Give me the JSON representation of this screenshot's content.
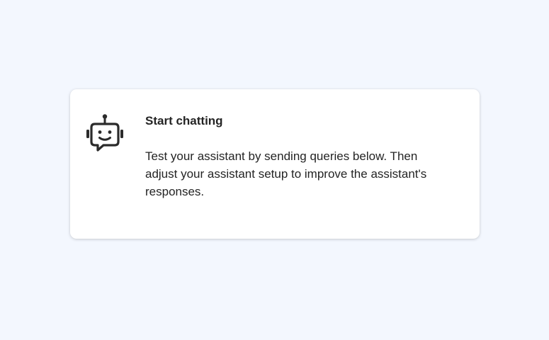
{
  "card": {
    "title": "Start chatting",
    "body": "Test your assistant by sending queries below. Then adjust your assistant setup to improve the assistant's responses.",
    "icon": "bot-icon"
  },
  "colors": {
    "background": "#f3f7fe",
    "card": "#ffffff",
    "text": "#242424"
  }
}
